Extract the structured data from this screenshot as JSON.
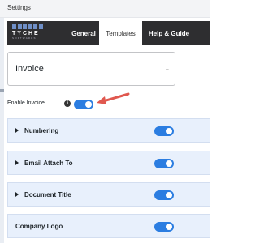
{
  "window": {
    "title": "Settings"
  },
  "logo": {
    "brand": "TYCHE",
    "sub": "SOFTWARES"
  },
  "tabs": [
    {
      "label": "General",
      "active": false
    },
    {
      "label": "Templates",
      "active": true
    },
    {
      "label": "Help & Guide",
      "active": false
    }
  ],
  "template_select": {
    "value": "Invoice"
  },
  "enable_invoice": {
    "label": "Enable Invoice",
    "info_icon": "info-icon",
    "on": true
  },
  "sections": [
    {
      "label": "Numbering",
      "expandable": true,
      "on": true
    },
    {
      "label": "Email Attach To",
      "expandable": true,
      "on": true
    },
    {
      "label": "Document Title",
      "expandable": true,
      "on": true
    },
    {
      "label": "Company Logo",
      "expandable": false,
      "on": true
    }
  ],
  "colors": {
    "accent": "#2b7de1",
    "navbar": "#2e2e30",
    "section_bg": "#e8f0fc",
    "arrow": "#e0584f"
  }
}
